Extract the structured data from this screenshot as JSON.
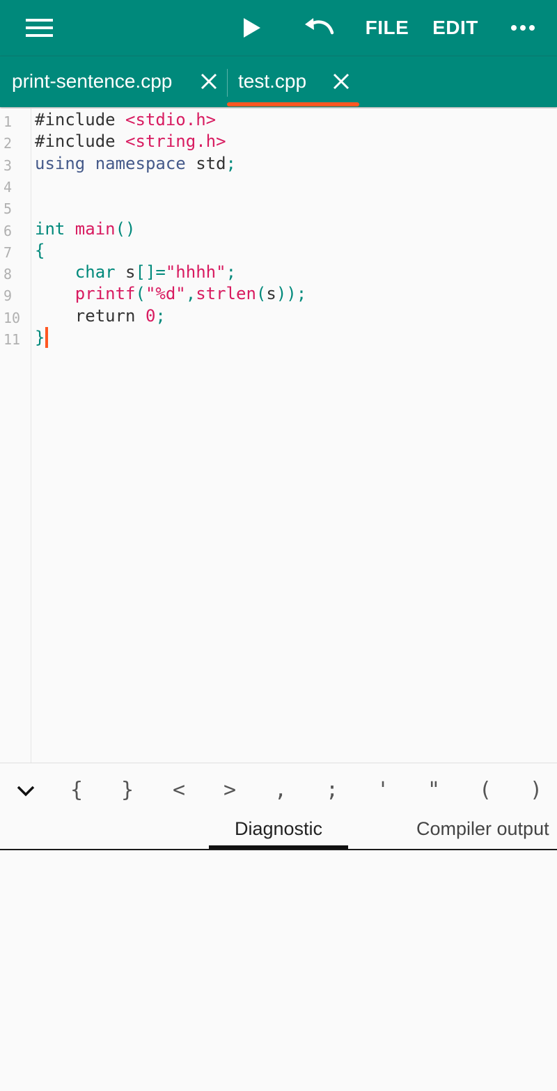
{
  "toolbar": {
    "menu_icon": "hamburger-menu-icon",
    "run_icon": "play-icon",
    "undo_icon": "undo-icon",
    "file_label": "FILE",
    "edit_label": "EDIT",
    "more_icon": "more-horizontal-icon",
    "background": "#00897b"
  },
  "tabs": [
    {
      "label": "print-sentence.cpp",
      "active": false
    },
    {
      "label": "test.cpp",
      "active": true
    }
  ],
  "tab_indicator_color": "#ff5722",
  "editor": {
    "lines": [
      {
        "no": "1",
        "tokens": [
          {
            "t": "#include ",
            "c": "def"
          },
          {
            "t": "<stdio.h>",
            "c": "str"
          }
        ]
      },
      {
        "no": "2",
        "tokens": [
          {
            "t": "#include ",
            "c": "def"
          },
          {
            "t": "<string.h>",
            "c": "str"
          }
        ]
      },
      {
        "no": "3",
        "tokens": [
          {
            "t": "using namespace ",
            "c": "ns"
          },
          {
            "t": "std",
            "c": "def"
          },
          {
            "t": ";",
            "c": "punc"
          }
        ]
      },
      {
        "no": "4",
        "tokens": []
      },
      {
        "no": "5",
        "tokens": []
      },
      {
        "no": "6",
        "tokens": [
          {
            "t": "int ",
            "c": "kw"
          },
          {
            "t": "main",
            "c": "fn"
          },
          {
            "t": "()",
            "c": "punc"
          }
        ]
      },
      {
        "no": "7",
        "tokens": [
          {
            "t": "{",
            "c": "punc"
          }
        ]
      },
      {
        "no": "8",
        "tokens": [
          {
            "t": "    ",
            "c": "def"
          },
          {
            "t": "char ",
            "c": "kw"
          },
          {
            "t": "s",
            "c": "def"
          },
          {
            "t": "[]=",
            "c": "punc"
          },
          {
            "t": "\"hhhh\"",
            "c": "str"
          },
          {
            "t": ";",
            "c": "punc"
          }
        ]
      },
      {
        "no": "9",
        "tokens": [
          {
            "t": "    ",
            "c": "def"
          },
          {
            "t": "printf",
            "c": "fn"
          },
          {
            "t": "(",
            "c": "punc"
          },
          {
            "t": "\"%d\"",
            "c": "str"
          },
          {
            "t": ",",
            "c": "punc"
          },
          {
            "t": "strlen",
            "c": "fn"
          },
          {
            "t": "(",
            "c": "punc"
          },
          {
            "t": "s",
            "c": "def"
          },
          {
            "t": "));",
            "c": "punc"
          }
        ]
      },
      {
        "no": "10",
        "tokens": [
          {
            "t": "    ",
            "c": "def"
          },
          {
            "t": "return ",
            "c": "def"
          },
          {
            "t": "0",
            "c": "num"
          },
          {
            "t": ";",
            "c": "punc"
          }
        ]
      },
      {
        "no": "11",
        "tokens": [
          {
            "t": "}",
            "c": "punc"
          }
        ],
        "caret": true
      }
    ]
  },
  "keybar": {
    "collapse_icon": "chevron-down-icon",
    "keys": [
      "{",
      "}",
      "<",
      ">",
      ",",
      ";",
      "'",
      "\"",
      "(",
      ")"
    ]
  },
  "bottom_tabs": [
    {
      "label": "Diagnostic",
      "active": true
    },
    {
      "label": "Compiler output",
      "active": false
    }
  ]
}
